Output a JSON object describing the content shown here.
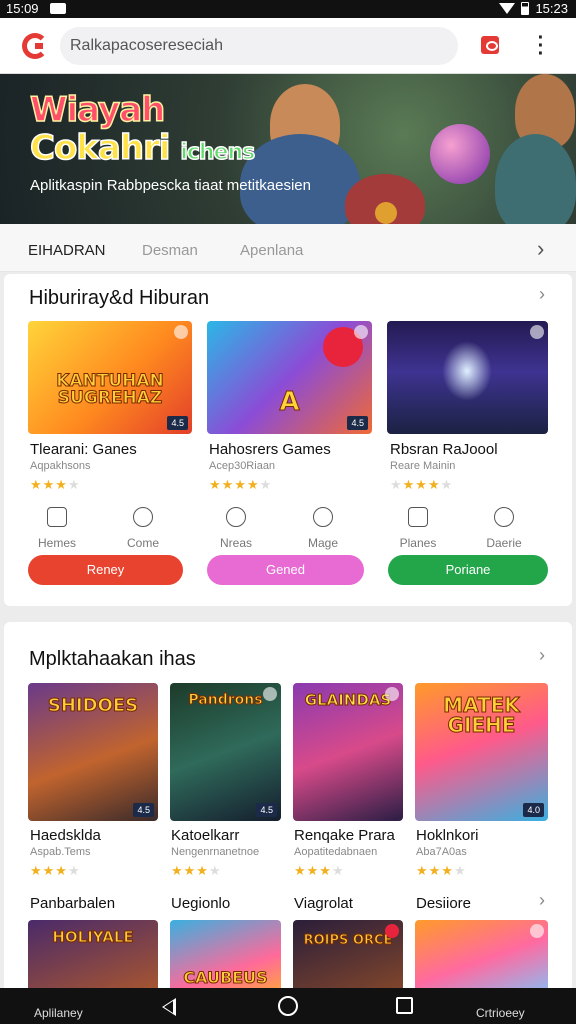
{
  "status": {
    "time": "15:09",
    "clock_right": "15:23"
  },
  "appbar": {
    "search_text": "Ralkapacosereseciah"
  },
  "hero": {
    "title_line1": "Wiayah",
    "title_line2": "Cokahri",
    "title_line2_small": "ichens",
    "subtitle": "Aplitkaspin Rabbpescka tiaat metitkaesien"
  },
  "tabs": [
    "EIHADRAN",
    "Desman",
    "Apenlana"
  ],
  "section1": {
    "title": "Hiburiray&d Hiburan",
    "games": [
      {
        "name": "Tlearani: Ganes",
        "sub": "Aqpakhsons",
        "rating": 3,
        "art": "KANTUHAN SUGREHAZ",
        "badge": "4.5"
      },
      {
        "name": "Hahosrers Games",
        "sub": "Acep30Riaan",
        "rating": 4,
        "art": "A",
        "badge": "4.5"
      },
      {
        "name": "Rbsran RaJoool",
        "sub": "Reare Mainin",
        "rating": 3,
        "art": "",
        "badge": ""
      }
    ],
    "categories": [
      "Hemes",
      "Come",
      "Nreas",
      "Mage",
      "Planes",
      "Daerie"
    ],
    "buttons": [
      "Reney",
      "Gened",
      "Poriane"
    ]
  },
  "section2": {
    "title": "Mplktahaakan ihas",
    "games": [
      {
        "name": "Haedsklda",
        "sub": "Aspab.Tems",
        "rating": 3,
        "art": "SHIDOES",
        "badge": "4.5"
      },
      {
        "name": "Katoelkarr",
        "sub": "Nengenrnanetnoe",
        "rating": 3,
        "art": "Pandrons",
        "badge": "4.5"
      },
      {
        "name": "Renqake Prara",
        "sub": "Aopatitedabnaen",
        "rating": 3,
        "art": "GLAINDAS",
        "badge": ""
      },
      {
        "name": "Hoklnkori",
        "sub": "Aba7A0as",
        "rating": 3,
        "art": "MATEK GIEHE",
        "badge": "4.0"
      }
    ],
    "labels2": [
      "Panbarbalen",
      "Uegionlo",
      "Viagrolat",
      "Desiiore"
    ],
    "thumb_art2": [
      "HOLIYALE",
      "CAUBEUS",
      "ROIPS ORCE",
      ""
    ]
  },
  "navbar": {
    "left_label": "Aplilaney",
    "right_label": "Crtrioeey"
  },
  "colors": {
    "accent": "#e53935",
    "pill_red": "#e8432e",
    "pill_pink": "#e86ad3",
    "pill_green": "#23a64a"
  }
}
